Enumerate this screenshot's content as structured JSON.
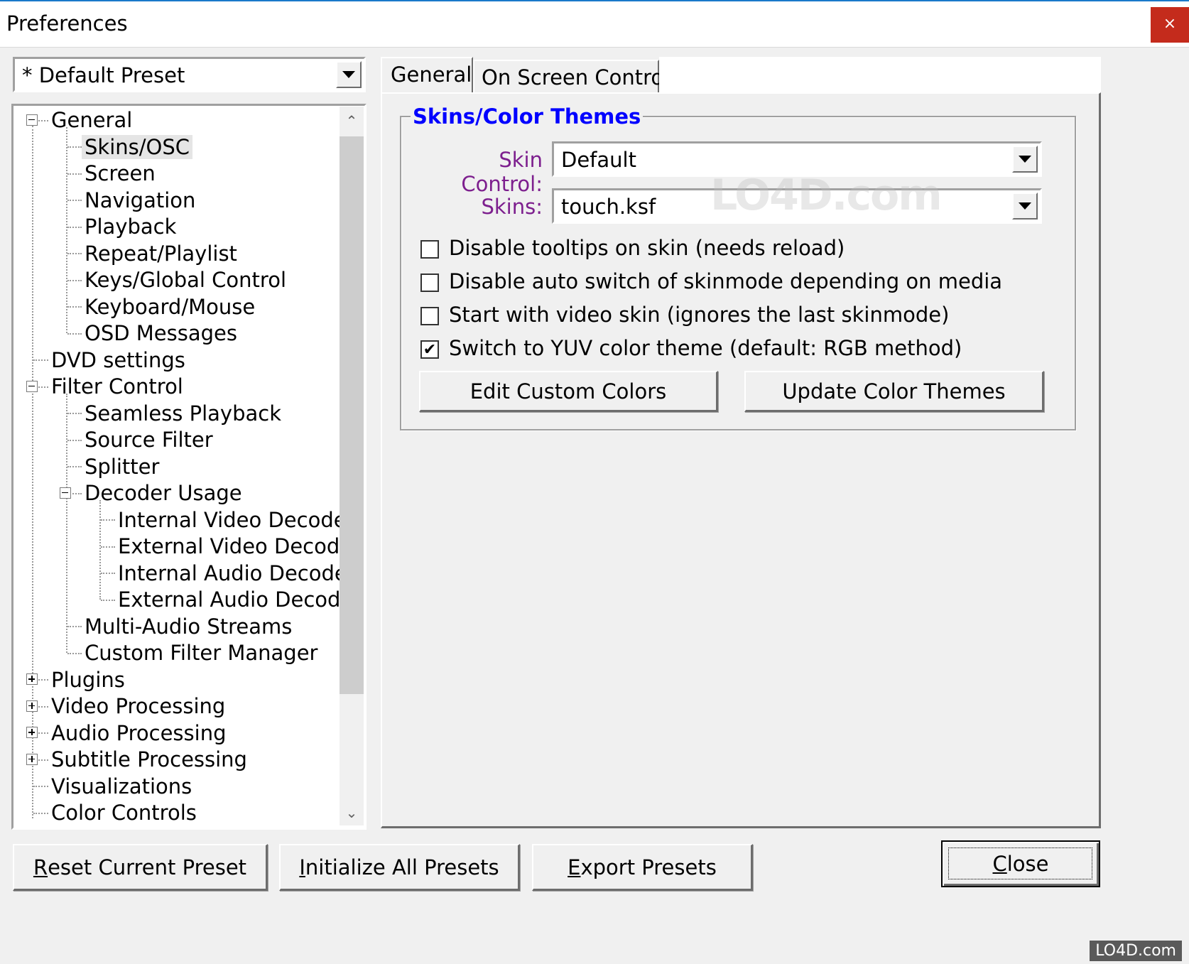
{
  "window": {
    "title": "Preferences",
    "close_glyph": "×"
  },
  "preset": {
    "selected": "* Default Preset"
  },
  "tree": {
    "items": [
      {
        "label": "General",
        "depth": 0,
        "expander": "minus"
      },
      {
        "label": "Skins/OSC",
        "depth": 1,
        "selected": true
      },
      {
        "label": "Screen",
        "depth": 1
      },
      {
        "label": "Navigation",
        "depth": 1
      },
      {
        "label": "Playback",
        "depth": 1
      },
      {
        "label": "Repeat/Playlist",
        "depth": 1
      },
      {
        "label": "Keys/Global Control",
        "depth": 1
      },
      {
        "label": "Keyboard/Mouse",
        "depth": 1
      },
      {
        "label": "OSD Messages",
        "depth": 1
      },
      {
        "label": "DVD settings",
        "depth": 0
      },
      {
        "label": "Filter Control",
        "depth": 0,
        "expander": "minus"
      },
      {
        "label": "Seamless Playback",
        "depth": 1
      },
      {
        "label": "Source Filter",
        "depth": 1
      },
      {
        "label": "Splitter",
        "depth": 1
      },
      {
        "label": "Decoder Usage",
        "depth": 1,
        "expander": "minus"
      },
      {
        "label": "Internal Video Decoder",
        "depth": 2
      },
      {
        "label": "External Video Decoder",
        "depth": 2
      },
      {
        "label": "Internal Audio Decoder",
        "depth": 2
      },
      {
        "label": "External Audio Decoder",
        "depth": 2
      },
      {
        "label": "Multi-Audio Streams",
        "depth": 1
      },
      {
        "label": "Custom Filter Manager",
        "depth": 1
      },
      {
        "label": "Plugins",
        "depth": 0,
        "expander": "plus"
      },
      {
        "label": "Video Processing",
        "depth": 0,
        "expander": "plus"
      },
      {
        "label": "Audio Processing",
        "depth": 0,
        "expander": "plus"
      },
      {
        "label": "Subtitle Processing",
        "depth": 0,
        "expander": "plus"
      },
      {
        "label": "Visualizations",
        "depth": 0
      },
      {
        "label": "Color Controls",
        "depth": 0
      }
    ]
  },
  "tabs": [
    {
      "label": "General",
      "active": true
    },
    {
      "label": "On Screen Control",
      "active": false
    }
  ],
  "group": {
    "title": "Skins/Color Themes",
    "skin_control_label": "Skin Control:",
    "skin_control_value": "Default",
    "skins_label": "Skins:",
    "skins_value": "touch.ksf"
  },
  "checkboxes": [
    {
      "label": "Disable tooltips on skin (needs reload)",
      "checked": false
    },
    {
      "label": "Disable auto switch of skinmode depending on media",
      "checked": false
    },
    {
      "label": "Start with video skin (ignores the last skinmode)",
      "checked": false
    },
    {
      "label": "Switch to YUV color theme (default: RGB method)",
      "checked": true
    }
  ],
  "buttons": {
    "edit_custom_colors": "Edit Custom Colors",
    "update_color_themes": "Update Color Themes",
    "reset_current_preset": {
      "underline": "R",
      "rest": "eset Current Preset"
    },
    "initialize_all_presets": {
      "underline": "I",
      "rest": "nitialize All Presets"
    },
    "export_presets": {
      "underline": "E",
      "rest": "xport Presets"
    },
    "close": {
      "underline": "C",
      "rest": "lose"
    }
  },
  "check_glyph": "✔",
  "watermark": {
    "large": "LO4D.com",
    "small": "LO4D.com"
  }
}
